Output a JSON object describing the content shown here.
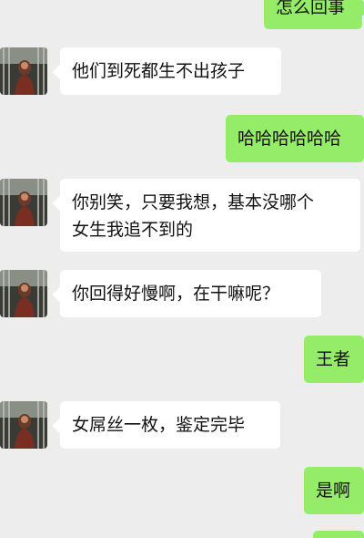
{
  "chat": {
    "colors": {
      "background": "#ededed",
      "incoming_bubble": "#ffffff",
      "outgoing_bubble": "#95ec69"
    },
    "contact": {
      "avatar_icon": "contact-avatar-photo"
    },
    "messages": [
      {
        "side": "right",
        "text": "怎么回事"
      },
      {
        "side": "left",
        "text": "他们到死都生不出孩子"
      },
      {
        "side": "right",
        "text": "哈哈哈哈哈哈"
      },
      {
        "side": "left",
        "lines": [
          "你别笑，只要我想，基本没哪个",
          "女生我追不到的"
        ]
      },
      {
        "side": "left",
        "text": "你回得好慢啊，在干嘛呢？"
      },
      {
        "side": "right",
        "text": "王者"
      },
      {
        "side": "left",
        "text": "女屌丝一枚，鉴定完毕"
      },
      {
        "side": "right",
        "text": "是啊"
      }
    ]
  }
}
